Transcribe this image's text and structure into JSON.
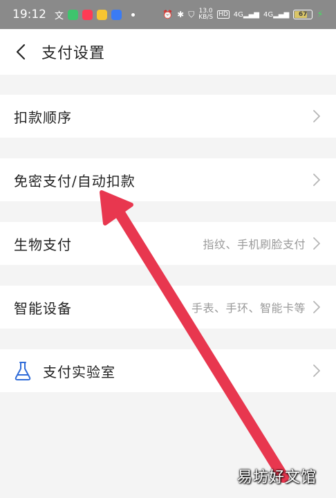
{
  "status_bar": {
    "time": "19:12",
    "net_speed_value": "13.0",
    "net_speed_unit": "KB/S",
    "hd_label": "HD",
    "signal1": "4G",
    "signal2": "4G",
    "battery_percent": "67"
  },
  "header": {
    "title": "支付设置"
  },
  "rows": [
    {
      "label": "扣款顺序",
      "value": ""
    },
    {
      "label": "免密支付/自动扣款",
      "value": ""
    },
    {
      "label": "生物支付",
      "value": "指纹、手机刷脸支付"
    },
    {
      "label": "智能设备",
      "value": "手表、手环、智能卡等"
    },
    {
      "label": "支付实验室",
      "value": ""
    }
  ],
  "watermark": "易坊好文馆",
  "colors": {
    "arrow": "#e8374f",
    "lab_icon": "#2f6bd8",
    "status_bar": "#8a8a8a"
  }
}
